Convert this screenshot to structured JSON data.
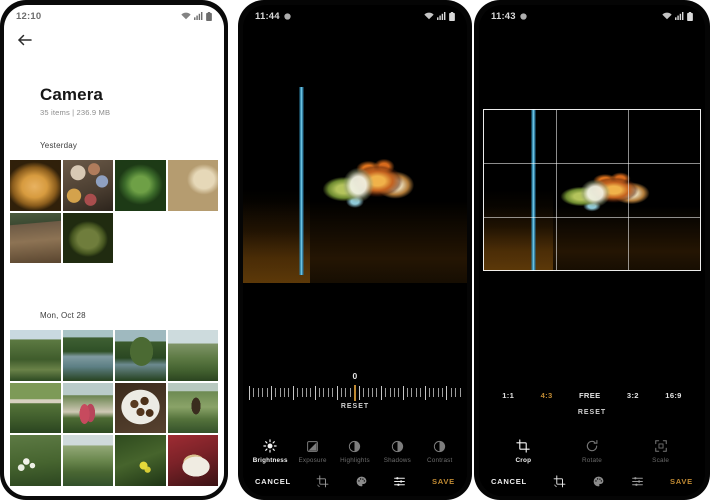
{
  "phone1": {
    "status": {
      "clock": "12:10",
      "icons": [
        "wifi-icon",
        "signal-icon",
        "battery-icon"
      ]
    },
    "back_button": "back-arrow-icon",
    "album": {
      "title": "Camera",
      "meta": "35 items | 236.9 MB"
    },
    "sections": [
      {
        "day_label": "Yesterday",
        "thumbs": [
          "pizza",
          "market",
          "noodle-soup",
          "bowls",
          "tables",
          "soup-bowl"
        ]
      },
      {
        "day_label": "Mon, Oct 28",
        "thumbs": [
          "hillside",
          "river",
          "tree-lake",
          "valley-road",
          "mountain-road",
          "two-people",
          "cooked-food",
          "person-carrying",
          "white-flowers",
          "canyon",
          "yellow-flower",
          "cake-plate"
        ]
      }
    ]
  },
  "phone2": {
    "status": {
      "clock": "11:44",
      "icons": [
        "notification-dot-icon",
        "wifi-icon",
        "signal-icon",
        "battery-icon"
      ]
    },
    "photo": "guppy-fish-aquarium",
    "slider": {
      "value": "0",
      "reset_label": "RESET"
    },
    "tools": [
      {
        "label": "Brightness",
        "icon": "brightness-sun-icon",
        "state": "active"
      },
      {
        "label": "Exposure",
        "icon": "exposure-square-icon",
        "state": "dim"
      },
      {
        "label": "Highlights",
        "icon": "highlights-circle-icon",
        "state": "dim"
      },
      {
        "label": "Shadows",
        "icon": "shadows-circle-icon",
        "state": "dim"
      },
      {
        "label": "Contrast",
        "icon": "contrast-circle-icon",
        "state": "dim"
      }
    ],
    "bottom": {
      "cancel": "CANCEL",
      "save": "SAVE",
      "icons": [
        {
          "name": "crop-rotate-icon",
          "state": "inactive"
        },
        {
          "name": "color-palette-icon",
          "state": "inactive"
        },
        {
          "name": "adjust-sliders-icon",
          "state": "active"
        }
      ]
    }
  },
  "phone3": {
    "status": {
      "clock": "11:43",
      "icons": [
        "notification-dot-icon",
        "wifi-icon",
        "signal-icon",
        "battery-icon"
      ]
    },
    "photo": "guppy-fish-aquarium",
    "crop_overlay": "rule-of-thirds-grid",
    "ratios": [
      {
        "label": "1:1",
        "selected": false
      },
      {
        "label": "4:3",
        "selected": true
      },
      {
        "label": "FREE",
        "selected": false
      },
      {
        "label": "3:2",
        "selected": false
      },
      {
        "label": "16:9",
        "selected": false
      }
    ],
    "reset_label": "RESET",
    "tools": [
      {
        "label": "Crop",
        "icon": "crop-icon",
        "state": "active"
      },
      {
        "label": "Rotate",
        "icon": "rotate-icon",
        "state": "dim"
      },
      {
        "label": "Scale",
        "icon": "scale-icon",
        "state": "dim"
      }
    ],
    "bottom": {
      "cancel": "CANCEL",
      "save": "SAVE",
      "icons": [
        {
          "name": "crop-rotate-icon",
          "state": "active"
        },
        {
          "name": "color-palette-icon",
          "state": "inactive"
        },
        {
          "name": "adjust-sliders-icon",
          "state": "inactive"
        }
      ]
    }
  },
  "theme": {
    "accent_gold": "#c08a33",
    "dark_bg": "#000000",
    "light_bg": "#ffffff"
  }
}
